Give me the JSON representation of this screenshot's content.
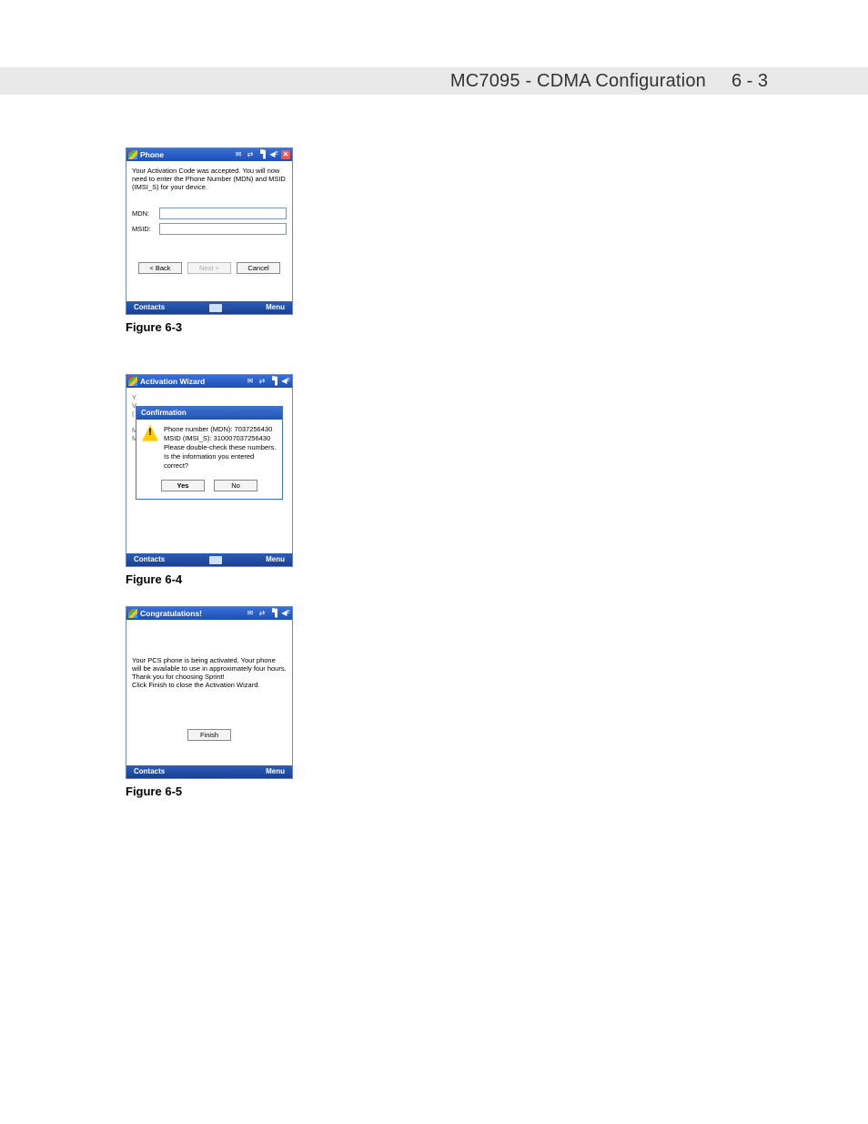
{
  "header": {
    "title": "MC7095 - CDMA Configuration",
    "page": "6 - 3"
  },
  "common": {
    "contacts": "Contacts",
    "menu": "Menu"
  },
  "fig1": {
    "title": "Phone",
    "message": "Your Activation Code was accepted. You will now need to enter the Phone Number (MDN) and MSID (IMSI_S) for your device.",
    "mdn_label": "MDN:",
    "msid_label": "MSID:",
    "back": "< Back",
    "next": "Next >",
    "cancel": "Cancel",
    "caption": "Figure 6-3"
  },
  "fig2": {
    "title": "Activation Wizard",
    "dialog_title": "Confirmation",
    "dialog_text": "Phone number (MDN): 7037256430\nMSID (IMSI_S): 310007037256430\nPlease double-check these numbers.\nIs the information you entered correct?",
    "yes": "Yes",
    "no": "No",
    "caption": "Figure 6-4"
  },
  "fig3": {
    "title": "Congratulations!",
    "message": "Your PCS phone is being activated. Your phone will be available to use in approximately four hours.\nThank you for choosing Sprint!\nClick Finish to close the Activation Wizard.",
    "finish": "Finish",
    "caption": "Figure 6-5"
  }
}
